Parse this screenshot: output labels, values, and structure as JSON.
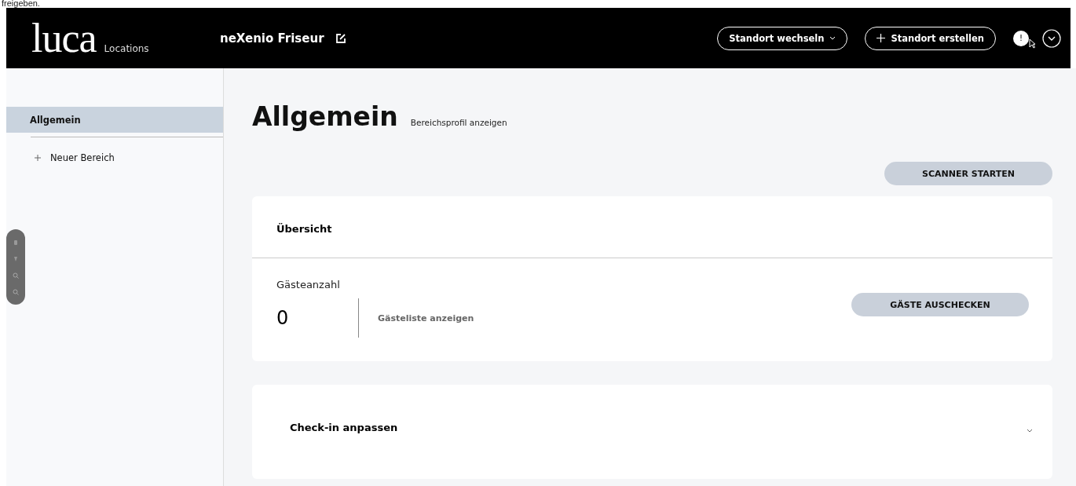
{
  "caption": "freigeben.",
  "header": {
    "logo": "luca",
    "product": "Locations",
    "location_name": "neXenio Friseur",
    "buttons": [
      {
        "label": "Standort wechseln",
        "kind": "dropdown"
      },
      {
        "label": "Standort erstellen",
        "kind": "add"
      }
    ],
    "notice": "!"
  },
  "sidebar": {
    "items": [
      {
        "label": "Allgemein",
        "selected": true,
        "kind": "area"
      },
      {
        "label": "Neuer Bereich",
        "selected": false,
        "kind": "add"
      }
    ]
  },
  "main": {
    "title": "Allgemein",
    "profile_link": "Bereichsprofil anzeigen",
    "scanner_button": "SCANNER STARTEN",
    "overview": {
      "title": "Übersicht",
      "guest_label": "Gästeanzahl",
      "guest_count": "0",
      "guest_list_link": "Gästeliste anzeigen",
      "checkout_button": "GÄSTE AUSCHECKEN"
    },
    "checkin": {
      "title": "Check-in anpassen",
      "expanded": false
    }
  }
}
